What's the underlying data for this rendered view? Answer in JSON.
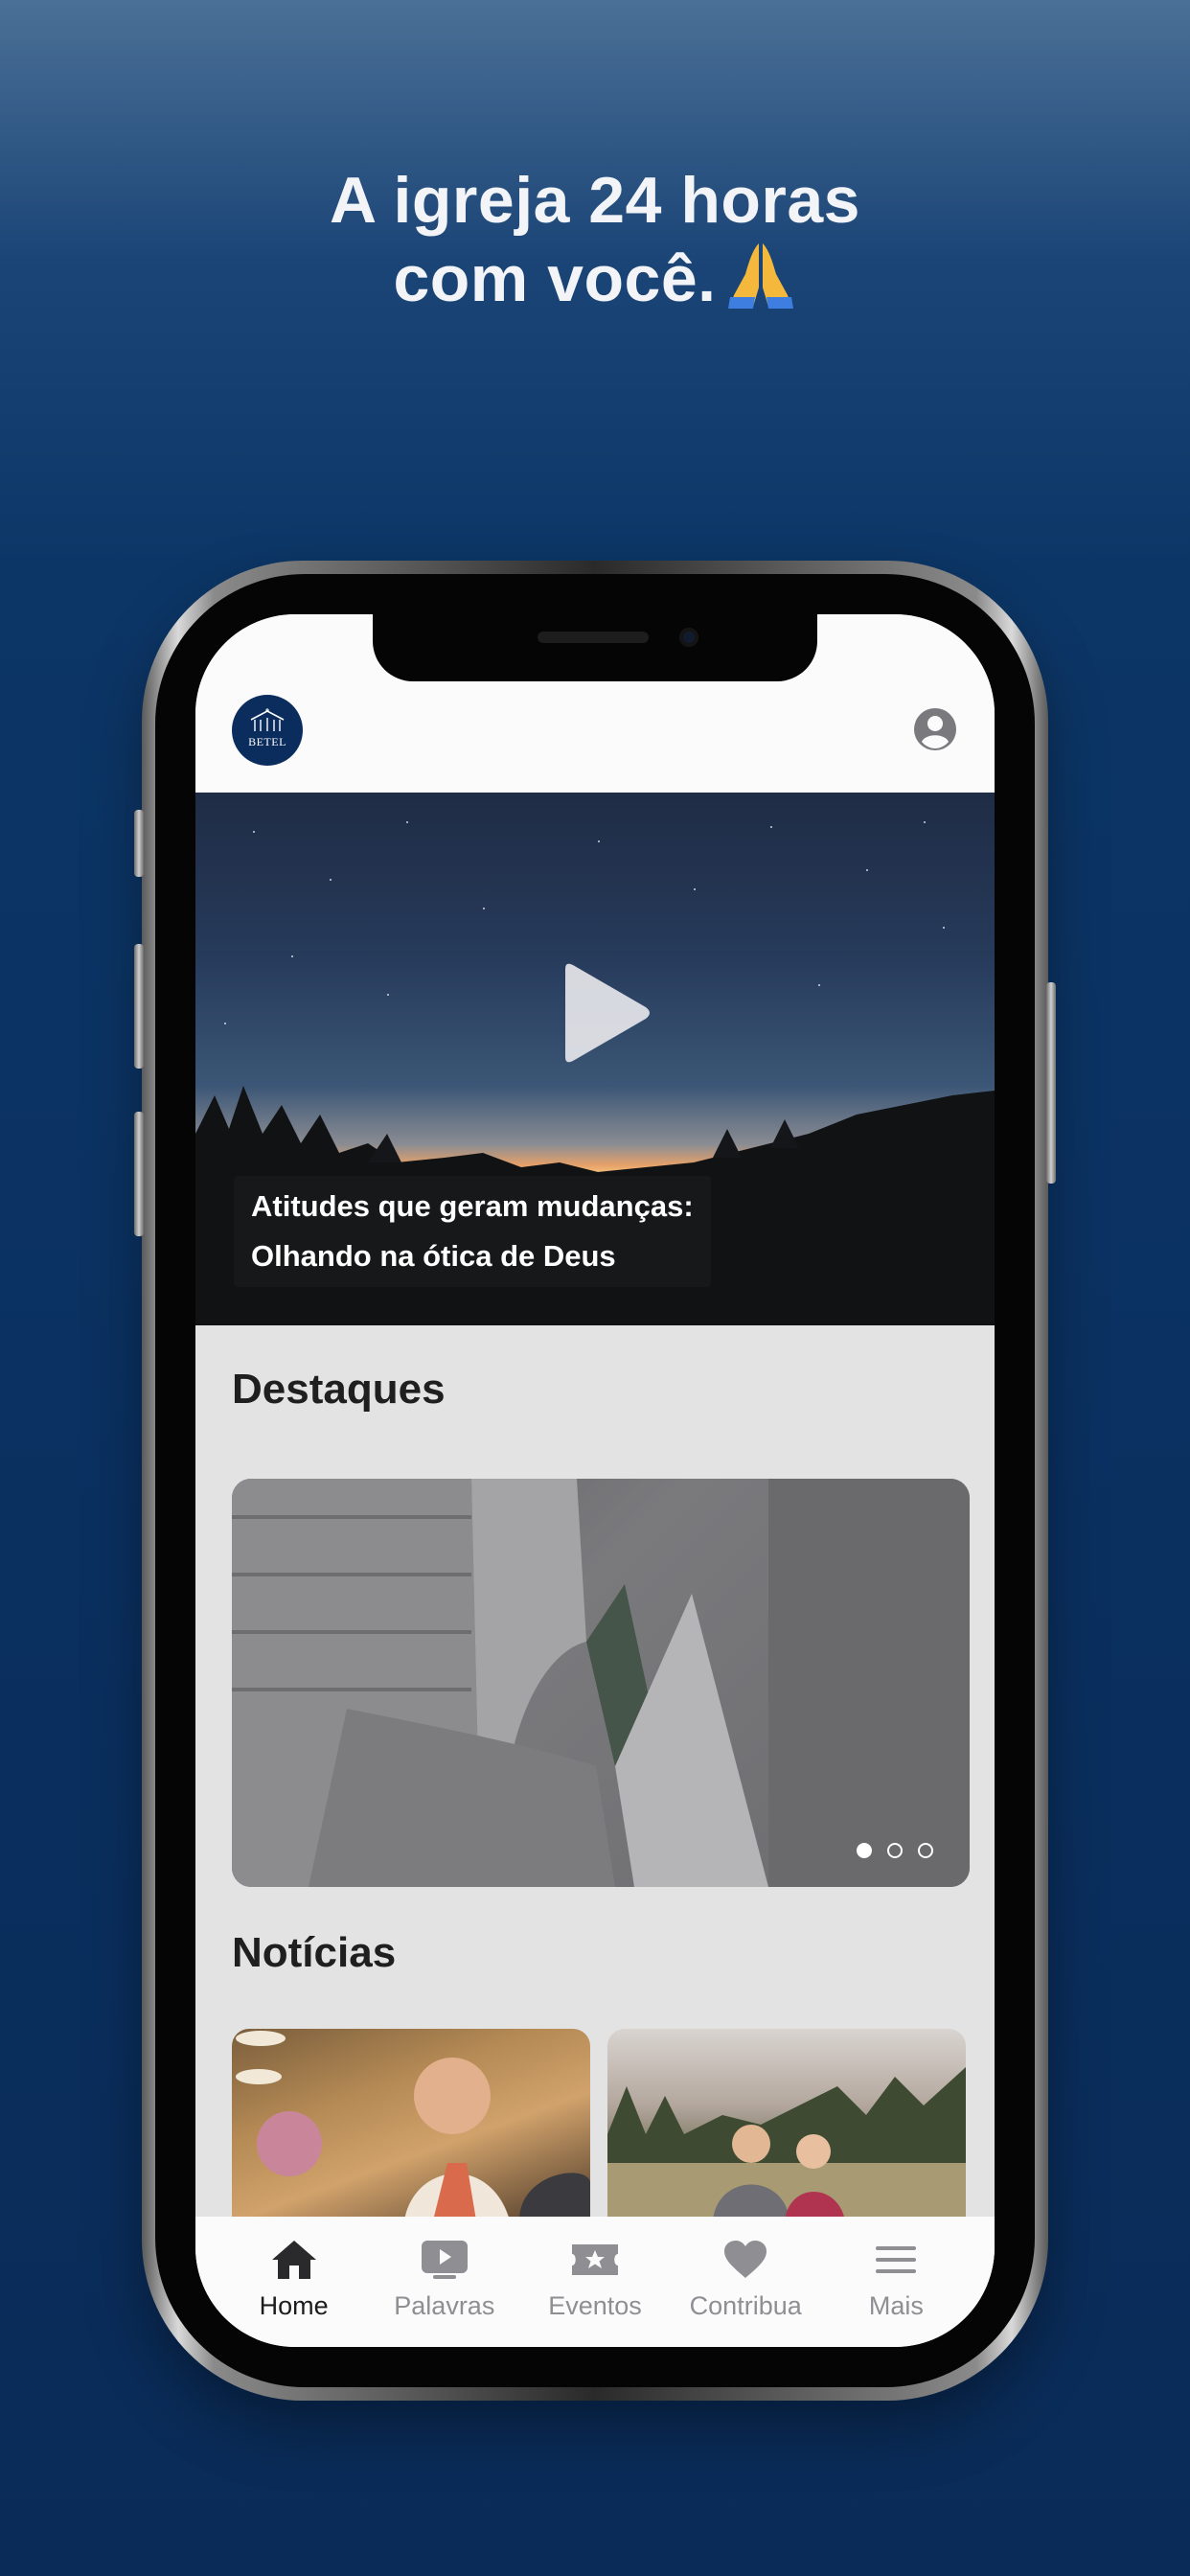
{
  "promo": {
    "headline_line1": "A igreja 24 horas",
    "headline_line2": "com você."
  },
  "app": {
    "logo_text": "BETEL",
    "hero": {
      "caption_line1": "Atitudes que geram mudanças:",
      "caption_line2": "Olhando na ótica de Deus"
    },
    "featured": {
      "title": "Destaques",
      "carousel_page": 1,
      "carousel_total": 3
    },
    "news": {
      "title": "Notícias"
    },
    "tabs": [
      {
        "label": "Home",
        "icon": "home-icon",
        "active": true
      },
      {
        "label": "Palavras",
        "icon": "video-icon",
        "active": false
      },
      {
        "label": "Eventos",
        "icon": "ticket-star-icon",
        "active": false
      },
      {
        "label": "Contribua",
        "icon": "heart-icon",
        "active": false
      },
      {
        "label": "Mais",
        "icon": "menu-icon",
        "active": false
      }
    ]
  },
  "colors": {
    "background": "#0c3666",
    "logo": "#0b2d5e",
    "tab_active": "#1c1c1e",
    "tab_inactive": "#8e8e93"
  }
}
